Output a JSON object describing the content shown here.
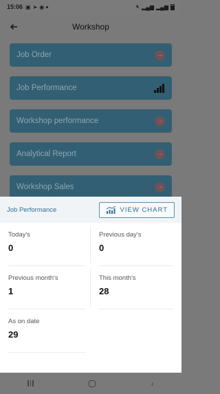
{
  "status_bar": {
    "time": "15:06"
  },
  "app_bar": {
    "title": "Workshop"
  },
  "menu": {
    "items": [
      {
        "label": "Job Order"
      },
      {
        "label": "Job Performance"
      },
      {
        "label": "Workshop performance"
      },
      {
        "label": "Analytical Report"
      },
      {
        "label": "Workshop Sales"
      }
    ]
  },
  "sheet": {
    "title": "Job Performance",
    "view_chart_label": "VIEW CHART",
    "stats": [
      {
        "label": "Today's",
        "value": "0"
      },
      {
        "label": "Previous day's",
        "value": "0"
      },
      {
        "label": "Previous month's",
        "value": "1"
      },
      {
        "label": "This month's",
        "value": "28"
      },
      {
        "label": "As on date",
        "value": "29"
      }
    ]
  },
  "colors": {
    "menu_item_bg": "#325f73",
    "accent": "#2c6e95",
    "scrim": "#7a7a7a"
  }
}
